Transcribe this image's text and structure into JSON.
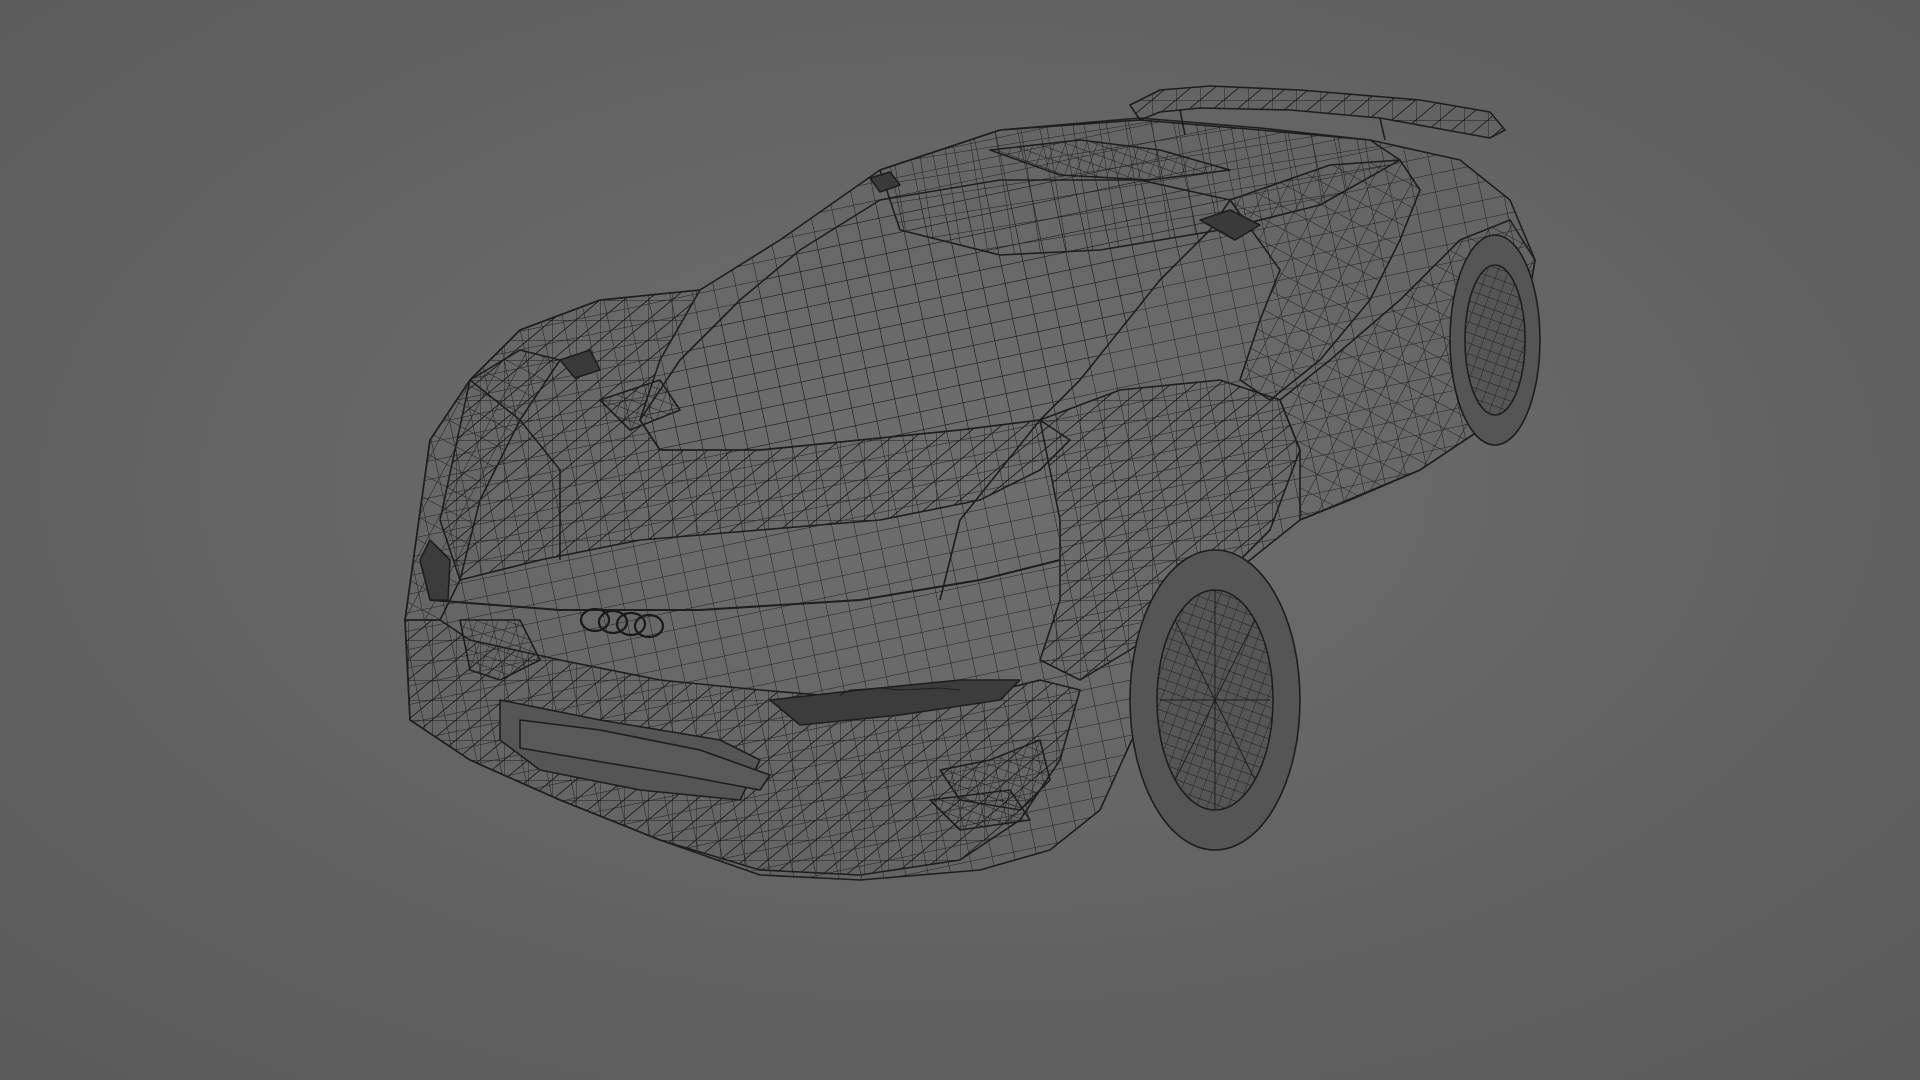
{
  "scene": {
    "subject": "wireframe-sports-car",
    "render_mode": "wireframe",
    "shading": "none",
    "colors": {
      "background_center": "#6c6c6c",
      "background_edge": "#5a5a5a",
      "wire": "#1e1e1e",
      "surface_tint": "#606060"
    },
    "icons": {
      "emblem": "four-rings-logo-icon"
    }
  }
}
